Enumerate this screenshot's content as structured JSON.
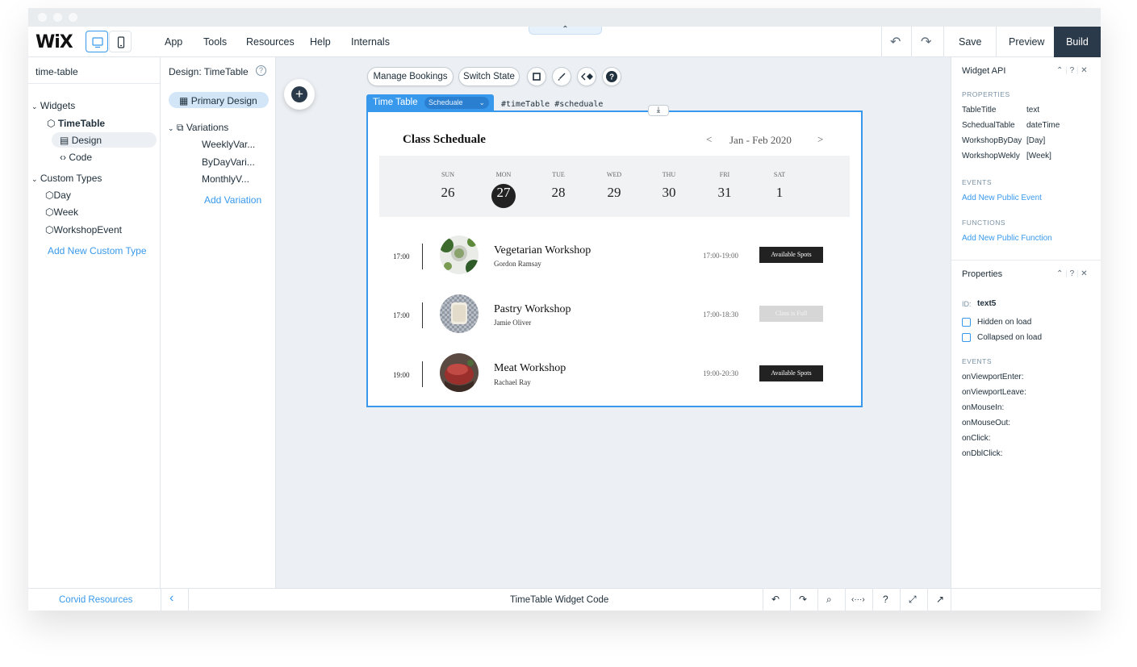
{
  "app": {
    "logo": "WiX"
  },
  "topbar": {
    "menu": [
      "App",
      "Tools",
      "Resources",
      "Help",
      "Internals"
    ],
    "save": "Save",
    "preview": "Preview",
    "build": "Build",
    "pull_tab_glyph": "⌃",
    "undo_glyph": "↶",
    "redo_glyph": "↷"
  },
  "left_panel": {
    "title": "time-table",
    "widgets_label": "Widgets",
    "timetable_label": "TimeTable",
    "design_label": "Design",
    "code_label": "Code",
    "custom_types_label": "Custom Types",
    "types": [
      "Day",
      "Week",
      "WorkshopEvent"
    ],
    "add_type": "Add New Custom Type"
  },
  "design_panel": {
    "title": "Design: TimeTable",
    "help_glyph": "?",
    "primary": "Primary Design",
    "variations_label": "Variations",
    "variations": [
      "WeeklyVar...",
      "ByDayVari...",
      "MonthlyV..."
    ],
    "add_variation": "Add Variation"
  },
  "canvas": {
    "manage_bookings": "Manage Bookings",
    "switch_state": "Switch State",
    "component_label": "Time Table",
    "state_select": "Scheduale",
    "ids": "#timeTable  #scheduale"
  },
  "widget": {
    "title": "Class Scheduale",
    "range": "Jan - Feb 2020",
    "prev": "<",
    "next": ">",
    "days": [
      {
        "name": "SUN",
        "num": "26"
      },
      {
        "name": "MON",
        "num": "27"
      },
      {
        "name": "TUE",
        "num": "28"
      },
      {
        "name": "WED",
        "num": "29"
      },
      {
        "name": "THU",
        "num": "30"
      },
      {
        "name": "FRI",
        "num": "31"
      },
      {
        "name": "SAT",
        "num": "1"
      }
    ],
    "selected_day_index": 1,
    "events": [
      {
        "time": "17:00",
        "name": "Vegetarian Workshop",
        "host": "Gordon Ramsay",
        "range": "17:00-19:00",
        "status": "Available Spots",
        "available": true
      },
      {
        "time": "17:00",
        "name": "Pastry Workshop",
        "host": "Jamie Oliver",
        "range": "17:00-18:30",
        "status": "Class is Full",
        "available": false
      },
      {
        "time": "19:00",
        "name": "Meat Workshop",
        "host": "Rachael Ray",
        "range": "19:00-20:30",
        "status": "Available Spots",
        "available": true
      }
    ]
  },
  "widget_api": {
    "title": "Widget API",
    "properties_label": "PROPERTIES",
    "properties": [
      {
        "key": "TableTitle",
        "value": "text"
      },
      {
        "key": "SchedualTable",
        "value": "dateTime"
      },
      {
        "key": "WorkshopByDay",
        "value": "[Day]"
      },
      {
        "key": "WorkshopWekly",
        "value": "[Week]"
      }
    ],
    "events_label": "EVENTS",
    "add_event": "Add New Public Event",
    "functions_label": "FUNCTIONS",
    "add_function": "Add New Public Function"
  },
  "properties_panel": {
    "title": "Properties",
    "id_label": "ID:",
    "id_value": "text5",
    "hidden": "Hidden on load",
    "collapsed": "Collapsed on load",
    "events_label": "EVENTS",
    "events": [
      "onViewportEnter:",
      "onViewportLeave:",
      "onMouseIn:",
      "onMouseOut:",
      "onClick:",
      "onDblClick:"
    ]
  },
  "bottombar": {
    "resources": "Corvid Resources",
    "code_title": "TimeTable Widget Code"
  },
  "colors": {
    "accent": "#3899ec",
    "dark": "#2b3a4a",
    "available_button": "#222222",
    "full_button": "#d6d6d6"
  }
}
